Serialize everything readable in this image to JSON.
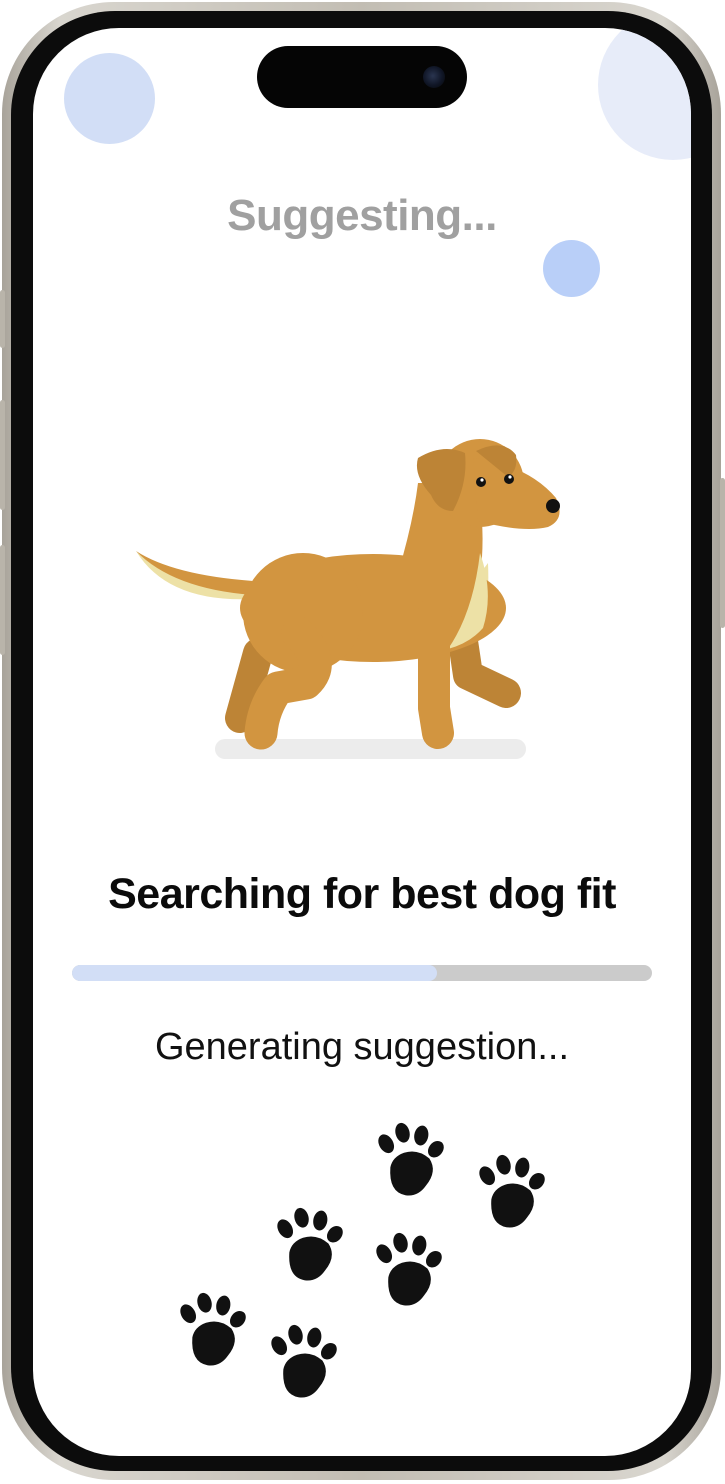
{
  "header": {
    "title": "Suggesting..."
  },
  "main": {
    "heading": "Searching for best dog fit",
    "status_text": "Generating suggestion...",
    "progress": 0.63
  },
  "icons": {
    "illustration": "walking-dog-illustration",
    "decoration": "paw-print-icon"
  },
  "colors": {
    "accent": "#d2def6",
    "title_gray": "#a0a0a0",
    "dog_body": "#d29540"
  }
}
